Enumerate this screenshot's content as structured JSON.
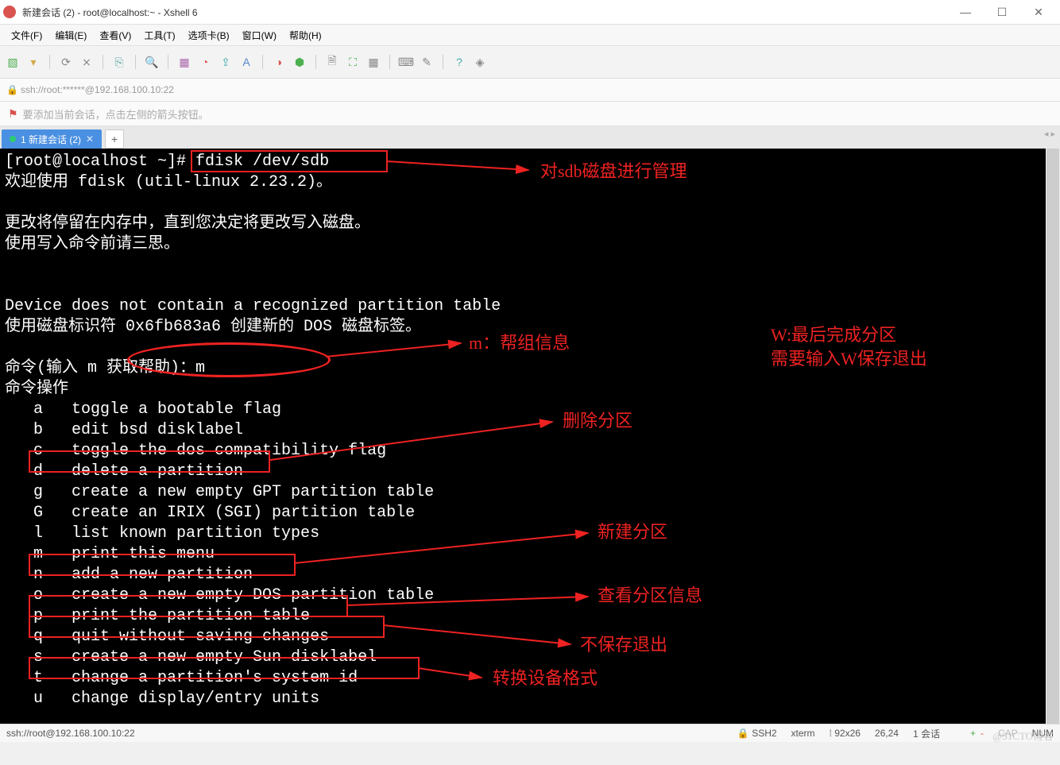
{
  "window": {
    "title": "新建会话 (2) - root@localhost:~ - Xshell 6"
  },
  "menubar": {
    "items": [
      "文件(F)",
      "编辑(E)",
      "查看(V)",
      "工具(T)",
      "选项卡(B)",
      "窗口(W)",
      "帮助(H)"
    ]
  },
  "addressbar": {
    "text": "ssh://root:******@192.168.100.10:22"
  },
  "hint": {
    "text": "要添加当前会话，点击左侧的箭头按钮。"
  },
  "tab": {
    "label": "1 新建会话 (2)"
  },
  "terminal": {
    "lines": [
      "[root@localhost ~]# fdisk /dev/sdb",
      "欢迎使用 fdisk (util-linux 2.23.2)。",
      "",
      "更改将停留在内存中，直到您决定将更改写入磁盘。",
      "使用写入命令前请三思。",
      "",
      "",
      "Device does not contain a recognized partition table",
      "使用磁盘标识符 0x6fb683a6 创建新的 DOS 磁盘标签。",
      "",
      "命令(输入 m 获取帮助)：m",
      "命令操作",
      "   a   toggle a bootable flag",
      "   b   edit bsd disklabel",
      "   c   toggle the dos compatibility flag",
      "   d   delete a partition",
      "   g   create a new empty GPT partition table",
      "   G   create an IRIX (SGI) partition table",
      "   l   list known partition types",
      "   m   print this menu",
      "   n   add a new partition",
      "   o   create a new empty DOS partition table",
      "   p   print the partition table",
      "   q   quit without saving changes",
      "   s   create a new empty Sun disklabel",
      "   t   change a partition's system id",
      "   u   change display/entry units"
    ]
  },
  "annotations": {
    "a1": "对sdb磁盘进行管理",
    "a2": "m：帮组信息",
    "a3": "W:最后完成分区",
    "a3b": "需要输入W保存退出",
    "a4": "删除分区",
    "a5": "新建分区",
    "a6": "查看分区信息",
    "a7": "不保存退出",
    "a8": "转换设备格式"
  },
  "status": {
    "left": "ssh://root@192.168.100.10:22",
    "ssh": "SSH2",
    "term": "xterm",
    "size": "92x26",
    "pos": "26,24",
    "sessions": "1 会话",
    "caps": "CAP",
    "num": "NUM"
  },
  "watermark": "@51CTO博客"
}
